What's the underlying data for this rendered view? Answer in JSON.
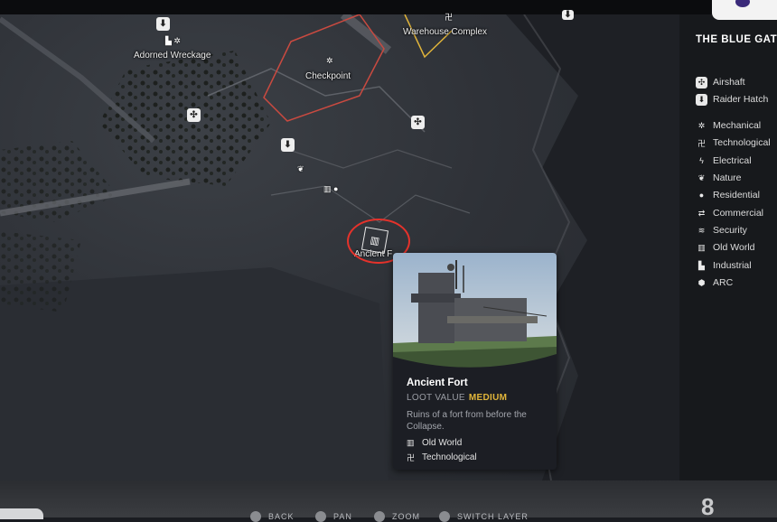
{
  "region": {
    "title": "THE BLUE GATE"
  },
  "legend": {
    "items": [
      {
        "label": "Airshaft",
        "icon": "airshaft-icon",
        "glyph": "✣",
        "boxed": true
      },
      {
        "label": "Raider Hatch",
        "icon": "raider-hatch-icon",
        "glyph": "⬇",
        "boxed": true
      },
      {
        "label": "Mechanical",
        "icon": "gear-icon",
        "glyph": "✲",
        "boxed": false
      },
      {
        "label": "Technological",
        "icon": "chip-icon",
        "glyph": "卍",
        "boxed": false
      },
      {
        "label": "Electrical",
        "icon": "lightning-icon",
        "glyph": "ϟ",
        "boxed": false
      },
      {
        "label": "Nature",
        "icon": "leaf-icon",
        "glyph": "❦",
        "boxed": false
      },
      {
        "label": "Residential",
        "icon": "person-icon",
        "glyph": "●",
        "boxed": false
      },
      {
        "label": "Commercial",
        "icon": "exchange-icon",
        "glyph": "⇄",
        "boxed": false
      },
      {
        "label": "Security",
        "icon": "shield-icon",
        "glyph": "≋",
        "boxed": false
      },
      {
        "label": "Old World",
        "icon": "book-icon",
        "glyph": "▥",
        "boxed": false
      },
      {
        "label": "Industrial",
        "icon": "factory-icon",
        "glyph": "▙",
        "boxed": false
      },
      {
        "label": "ARC",
        "icon": "arc-icon",
        "glyph": "⬢",
        "boxed": false
      }
    ]
  },
  "map": {
    "labels": {
      "adorned_wreckage": "Adorned Wreckage",
      "checkpoint": "Checkpoint",
      "warehouse_complex": "Warehouse Complex",
      "ancient_partial": "Ancient F"
    },
    "zone_colors": {
      "checkpoint": "#c94a40",
      "warehouse": "#e0b43a"
    }
  },
  "popup": {
    "title": "Ancient Fort",
    "loot_label": "LOOT VALUE",
    "loot_value": "MEDIUM",
    "description": "Ruins of a fort from before the Collapse.",
    "tags": [
      {
        "label": "Old World",
        "icon": "book-icon",
        "glyph": "▥"
      },
      {
        "label": "Technological",
        "icon": "chip-icon",
        "glyph": "卍"
      }
    ]
  },
  "controls": {
    "hints": [
      "BACK",
      "PAN",
      "ZOOM",
      "SWITCH LAYER"
    ]
  },
  "colors": {
    "accent_gold": "#e2b63a",
    "highlight_red": "#e5322b"
  }
}
